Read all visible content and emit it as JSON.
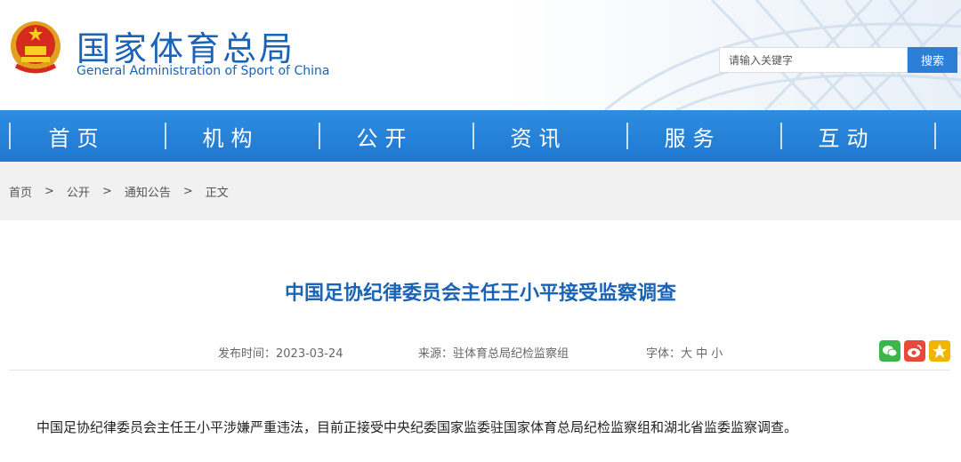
{
  "header": {
    "title_cn": "国家体育总局",
    "title_en": "General Administration of Sport of China",
    "search": {
      "placeholder": "请输入关键字",
      "button": "搜索"
    }
  },
  "nav": [
    "首页",
    "机构",
    "公开",
    "资讯",
    "服务",
    "互动"
  ],
  "breadcrumb": [
    "首页",
    ">",
    "公开",
    ">",
    "通知公告",
    ">",
    "正文"
  ],
  "article": {
    "title": "中国足协纪律委员会主任王小平接受监察调查",
    "publish": "发布时间：2023-03-24",
    "source": "来源：驻体育总局纪检监察组",
    "font_size": "字体：大 中 小",
    "body": "中国足协纪律委员会主任王小平涉嫌严重违法，目前正接受中央纪委国家监委驻国家体育总局纪检监察组和湖北省监委监察调查。"
  },
  "share": [
    "wechat-icon",
    "weibo-icon",
    "qzone-icon"
  ],
  "colors": {
    "brand": "#1a63b5",
    "nav": "#2583d8",
    "wechat": "#3bb64a",
    "weibo": "#e84a3a",
    "qzone": "#f2b400"
  }
}
